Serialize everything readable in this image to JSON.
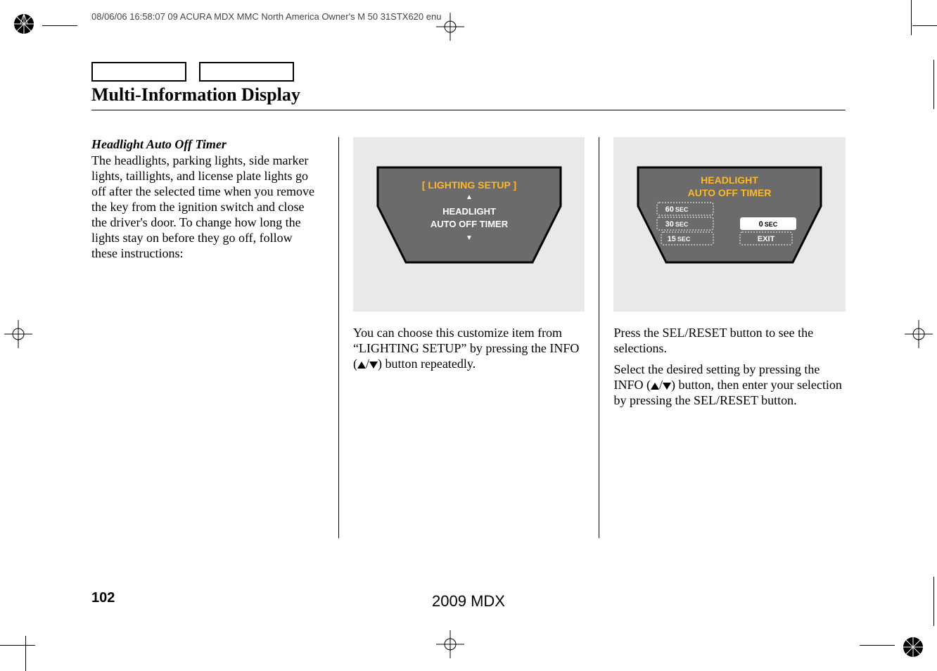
{
  "header": "08/06/06 16:58:07   09 ACURA MDX MMC North America Owner's M 50 31STX620 enu",
  "title": "Multi-Information Display",
  "col1": {
    "subheading": "Headlight Auto Off Timer",
    "body": "The headlights, parking lights, side marker lights, taillights, and license plate lights go off after the selected time when you remove the key from the ignition switch and close the driver's door. To change how long the lights stay on before they go off, follow these instructions:"
  },
  "col2": {
    "screen": {
      "bracket": "[ LIGHTING SETUP ]",
      "line1": "HEADLIGHT",
      "line2": "AUTO OFF TIMER"
    },
    "body_a": "You can choose this customize item from “LIGHTING SETUP” by pressing the INFO (",
    "body_b": "/",
    "body_c": ") button repeatedly."
  },
  "col3": {
    "screen": {
      "line1": "HEADLIGHT",
      "line2": "AUTO OFF TIMER",
      "opt60": "60",
      "opt30": "30",
      "opt15": "15",
      "opt0": "0",
      "sec": "SEC",
      "exit": "EXIT"
    },
    "body1": "Press the SEL/RESET button to see the selections.",
    "body2_a": "Select the desired setting by pressing the INFO (",
    "body2_b": "/",
    "body2_c": ") button, then enter your selection by pressing the SEL/RESET button."
  },
  "page_number": "102",
  "footer_model": "2009  MDX"
}
